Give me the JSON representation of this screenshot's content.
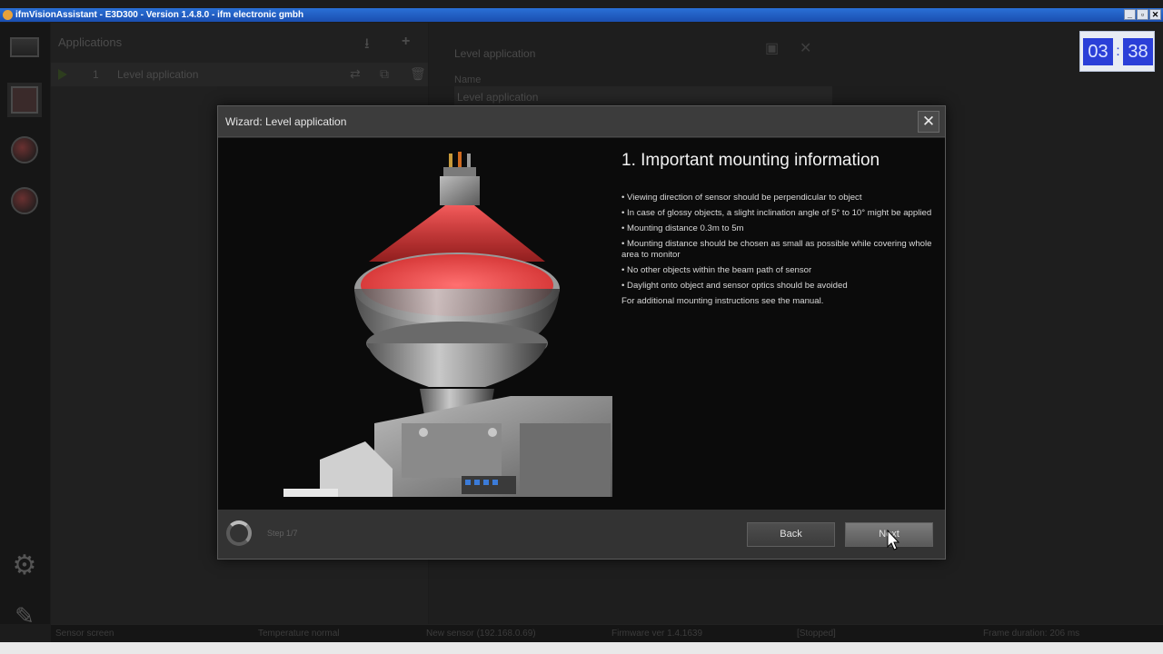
{
  "window": {
    "title": "ifmVisionAssistant - E3D300 - Version 1.4.8.0 - ifm electronic gmbh",
    "buttons": [
      "_",
      "▫",
      "✕"
    ]
  },
  "timer": {
    "minutes": "03",
    "seconds": "38"
  },
  "applications": {
    "header": "Applications",
    "items": [
      {
        "number": "1",
        "name": "Level application"
      }
    ]
  },
  "editor": {
    "title": "Level application",
    "name_label": "Name",
    "name_value": "Level application"
  },
  "wizard": {
    "title": "Wizard: Level application",
    "close": "✕",
    "heading": "1. Important mounting information",
    "bullets": [
      "• Viewing direction of sensor should be perpendicular to object",
      "• In case of glossy objects, a slight inclination angle of 5° to 10° might be applied",
      "• Mounting distance 0.3m to 5m",
      "• Mounting distance should be chosen as small as possible while covering whole area to monitor",
      "• No other objects within the beam path of sensor",
      "• Daylight onto object and sensor optics should be avoided"
    ],
    "note": "For additional mounting instructions see the manual.",
    "step": "Step 1/7",
    "back_label": "Back",
    "next_label": "Next"
  },
  "statusbar": {
    "screen": "Sensor screen",
    "temperature": "Temperature normal",
    "sensor": "New sensor (192.168.0.69)",
    "firmware": "Firmware ver 1.4.1639",
    "state": "[Stopped]",
    "frame": "Frame duration: 206 ms"
  }
}
